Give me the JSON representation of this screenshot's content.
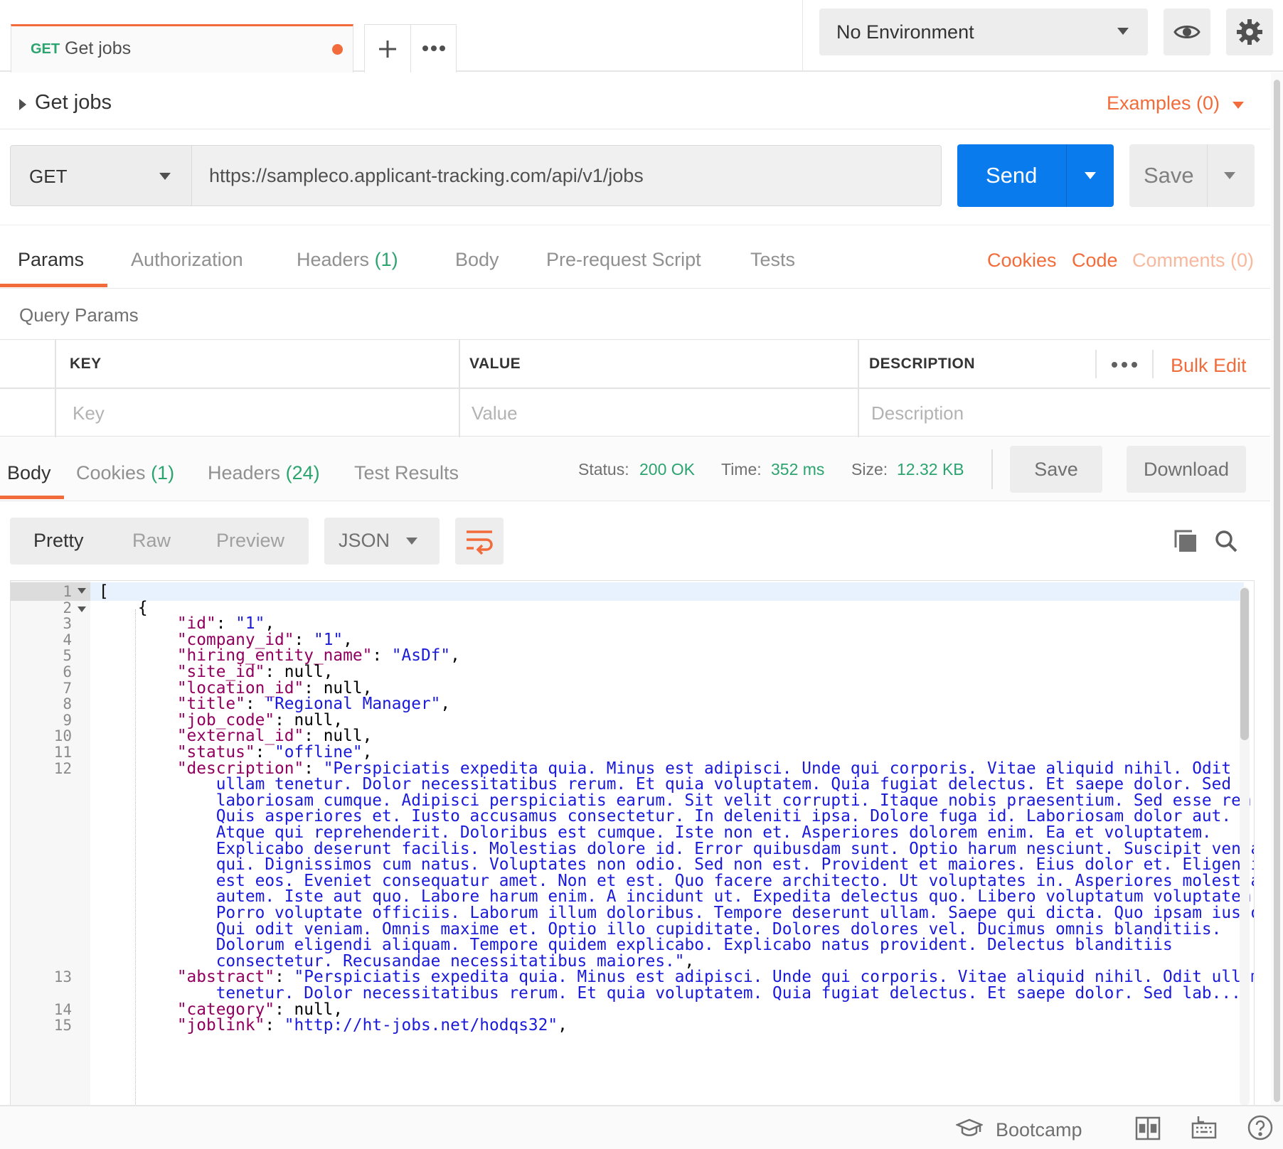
{
  "tab": {
    "method": "GET",
    "title": "Get jobs"
  },
  "environment": {
    "selected": "No Environment"
  },
  "request": {
    "name": "Get jobs",
    "examples_label": "Examples (0)",
    "method": "GET",
    "url": "https://sampleco.applicant-tracking.com/api/v1/jobs",
    "send_label": "Send",
    "save_label": "Save"
  },
  "request_tabs": {
    "params": "Params",
    "authorization": "Authorization",
    "headers": "Headers",
    "headers_count": "(1)",
    "body": "Body",
    "prerequest": "Pre-request Script",
    "tests": "Tests",
    "cookies": "Cookies",
    "code": "Code",
    "comments": "Comments (0)"
  },
  "query_params": {
    "title": "Query Params",
    "col_key": "KEY",
    "col_value": "VALUE",
    "col_description": "DESCRIPTION",
    "bulk_edit": "Bulk Edit",
    "key_placeholder": "Key",
    "value_placeholder": "Value",
    "description_placeholder": "Description"
  },
  "response_tabs": {
    "body": "Body",
    "cookies": "Cookies",
    "cookies_count": "(1)",
    "headers": "Headers",
    "headers_count": "(24)",
    "test_results": "Test Results"
  },
  "response_status": {
    "status_label": "Status:",
    "status_value": "200 OK",
    "time_label": "Time:",
    "time_value": "352 ms",
    "size_label": "Size:",
    "size_value": "12.32 KB",
    "save_label": "Save",
    "download_label": "Download"
  },
  "format_toolbar": {
    "pretty": "Pretty",
    "raw": "Raw",
    "preview": "Preview",
    "language": "JSON"
  },
  "code_lines": [
    {
      "n": "1",
      "text": "["
    },
    {
      "n": "2",
      "text": "    {"
    },
    {
      "n": "3",
      "key": "\"id\"",
      "sep": ": ",
      "val": "\"1\"",
      "end": ","
    },
    {
      "n": "4",
      "key": "\"company_id\"",
      "sep": ": ",
      "val": "\"1\"",
      "end": ","
    },
    {
      "n": "5",
      "key": "\"hiring_entity_name\"",
      "sep": ": ",
      "val": "\"AsDf\"",
      "end": ","
    },
    {
      "n": "6",
      "key": "\"site_id\"",
      "sep": ": null,"
    },
    {
      "n": "7",
      "key": "\"location_id\"",
      "sep": ": null,"
    },
    {
      "n": "8",
      "key": "\"title\"",
      "sep": ": ",
      "val": "\"Regional Manager\"",
      "end": ","
    },
    {
      "n": "9",
      "key": "\"job_code\"",
      "sep": ": null,"
    },
    {
      "n": "10",
      "key": "\"external_id\"",
      "sep": ": null,"
    },
    {
      "n": "11",
      "key": "\"status\"",
      "sep": ": ",
      "val": "\"offline\"",
      "end": ","
    },
    {
      "n": "12",
      "key": "\"description\"",
      "sep": ": ",
      "val": "\"Perspiciatis expedita quia. Minus est adipisci. Unde qui corporis. Vitae aliquid nihil. Odit"
    },
    {
      "val": "ullam tenetur. Dolor necessitatibus rerum. Et quia voluptatem. Quia fugiat delectus. Et saepe dolor. Sed"
    },
    {
      "val": "laboriosam cumque. Adipisci perspiciatis earum. Sit velit corrupti. Itaque nobis praesentium. Sed esse rem."
    },
    {
      "val": "Quis asperiores et. Iusto accusamus consectetur. In deleniti ipsa. Dolore fuga id. Laboriosam dolor aut."
    },
    {
      "val": "Atque qui reprehenderit. Doloribus est cumque. Iste non et. Asperiores dolorem enim. Ea et voluptatem."
    },
    {
      "val": "Explicabo deserunt facilis. Molestias dolore id. Error quibusdam sunt. Optio harum nesciunt. Suscipit veniam"
    },
    {
      "val": "qui. Dignissimos cum natus. Voluptates non odio. Sed non est. Provident et maiores. Eius dolor et. Eligendi"
    },
    {
      "val": "est eos. Eveniet consequatur amet. Non et est. Quo facere architecto. Ut voluptates in. Asperiores molestiae"
    },
    {
      "val": "autem. Iste aut quo. Labore harum enim. A incidunt ut. Expedita delectus quo. Libero voluptatum voluptatem."
    },
    {
      "val": "Porro voluptate officiis. Laborum illum doloribus. Tempore deserunt ullam. Saepe qui dicta. Quo ipsam iusto."
    },
    {
      "val": "Qui odit veniam. Omnis maxime et. Optio illo cupiditate. Dolores dolores vel. Ducimus omnis blanditiis."
    },
    {
      "val": "Dolorum eligendi aliquam. Tempore quidem explicabo. Explicabo natus provident. Delectus blanditiis"
    },
    {
      "val": "consectetur. Recusandae necessitatibus maiores.\"",
      "end": ","
    },
    {
      "n": "13",
      "key": "\"abstract\"",
      "sep": ": ",
      "val": "\"Perspiciatis expedita quia. Minus est adipisci. Unde qui corporis. Vitae aliquid nihil. Odit ullam"
    },
    {
      "val": "tenetur. Dolor necessitatibus rerum. Et quia voluptatem. Quia fugiat delectus. Et saepe dolor. Sed lab...\"",
      "end": ","
    },
    {
      "n": "14",
      "key": "\"category\"",
      "sep": ": null,"
    },
    {
      "n": "15",
      "key": "\"joblink\"",
      "sep": ": ",
      "val": "\"http://ht-jobs.net/hodqs32\"",
      "end": ","
    }
  ],
  "statusbar": {
    "bootcamp": "Bootcamp"
  },
  "icons": {
    "add": "plus-icon",
    "more": "ellipsis-icon",
    "eye": "eye-icon",
    "settings": "gear-icon",
    "copy": "copy-icon",
    "search": "search-icon",
    "wrap": "wrap-lines-icon",
    "bootcamp": "graduation-cap-icon",
    "layout": "two-pane-icon",
    "keyboard": "keyboard-icon",
    "help": "help-icon"
  },
  "colors": {
    "accent": "#f26b3a",
    "send": "#097bed",
    "success": "#2ba46f",
    "json_key": "#91005f",
    "json_string": "#1a1ad8"
  }
}
